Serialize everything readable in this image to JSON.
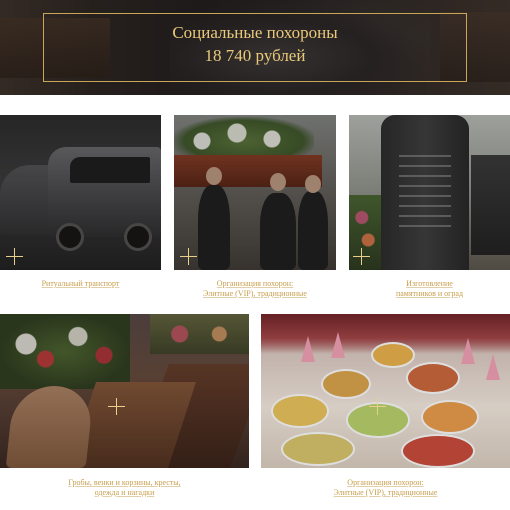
{
  "hero": {
    "title_line1": "Социальные похороны",
    "title_line2": "18 740 рублей"
  },
  "tiles": [
    {
      "caption_lines": [
        "Ритуальный транспорт"
      ]
    },
    {
      "caption_lines": [
        "Организация похорон:",
        "Элитные (VIP), традиционные"
      ]
    },
    {
      "caption_lines": [
        "Изготовление",
        "памятников и оград"
      ]
    },
    {
      "caption_lines": [
        "Гробы, венки и корзины, кресты,",
        "одежда и нагадки"
      ]
    },
    {
      "caption_lines": [
        "Организация похорон:",
        "Элитные (VIP), традиционные"
      ]
    }
  ],
  "colors": {
    "accent_gold": "#c79e4b",
    "hero_title": "#e9c97a"
  }
}
